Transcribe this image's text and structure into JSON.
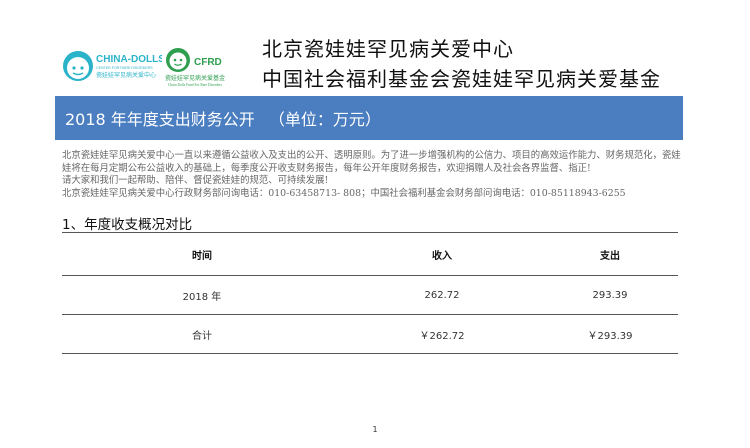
{
  "header": {
    "logos": {
      "china_dolls": {
        "name": "CHINA-DOLLS",
        "subtitle_en": "CENTER FOR RARE DISORDERS",
        "subtitle_cn": "瓷娃娃罕见病关爱中心",
        "color": "#2ab3c9"
      },
      "cfrd": {
        "name": "CFRD",
        "subtitle_cn": "瓷娃娃罕见病关爱基金",
        "subtitle_en": "China Dolls Fund For Rare Disorders",
        "color": "#2e9e4f"
      }
    },
    "org_names": [
      "北京瓷娃娃罕见病关爱中心",
      "中国社会福利基金会瓷娃娃罕见病关爱基金"
    ]
  },
  "banner": {
    "title": "2018 年年度支出财务公开",
    "unit": "（单位：万元）",
    "color": "#4a7ec0"
  },
  "intro": [
    "北京瓷娃娃罕见病关爱中心一直以来遵循公益收入及支出的公开、透明原则。为了进一步增强机构的公信力、项目的高效运作能力、财务规范化，瓷娃",
    "娃将在每月定期公布公益收入的基础上，每季度公开收支财务报告，每年公开年度财务报告，欢迎捐赠人及社会各界监督、指正!",
    "请大家和我们一起帮助、陪伴、督促瓷娃娃的规范、可持续发展!",
    "北京瓷娃娃罕见病关爱中心行政财务部问询电话：010-63458713- 808；中国社会福利基金会财务部问询电话：010-85118943-6255"
  ],
  "section1": {
    "title": "1、年度收支概况对比",
    "table": {
      "headers": [
        "时间",
        "收入",
        "支出"
      ],
      "rows": [
        [
          "2018 年",
          "262.72",
          "293.39"
        ],
        [
          "合计",
          "￥262.72",
          "￥293.39"
        ]
      ]
    }
  },
  "footer": {
    "page_number": "1"
  }
}
